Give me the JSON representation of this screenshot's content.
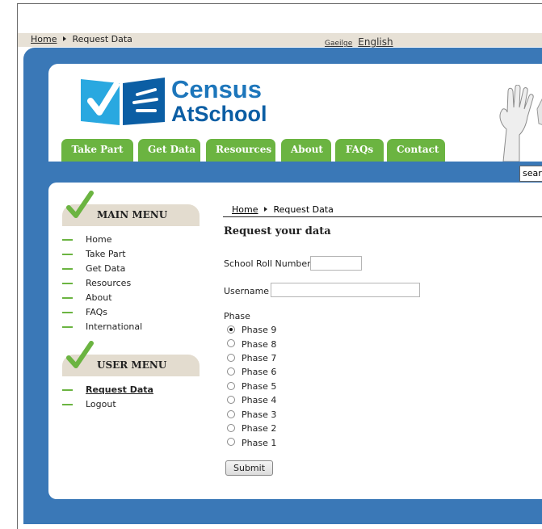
{
  "breadcrumb": {
    "home": "Home",
    "current": "Request Data"
  },
  "languages": {
    "irish": "Gaeilge",
    "english": "English"
  },
  "logo": {
    "line1": "Census",
    "line2": "AtSchool"
  },
  "nav_tabs": [
    "Take Part",
    "Get Data",
    "Resources",
    "About",
    "FAQs",
    "Contact"
  ],
  "search": {
    "value": "sear"
  },
  "main_menu": {
    "title": "MAIN MENU",
    "items": [
      "Home",
      "Take Part",
      "Get Data",
      "Resources",
      "About",
      "FAQs",
      "International"
    ]
  },
  "user_menu": {
    "title": "USER MENU",
    "items": [
      "Request Data",
      "Logout"
    ],
    "active": "Request Data"
  },
  "page": {
    "breadcrumb_home": "Home",
    "breadcrumb_current": "Request Data",
    "title": "Request your data",
    "school_roll_label": "School Roll Number",
    "school_roll_value": "",
    "username_label": "Username",
    "username_value": "",
    "phase_label": "Phase",
    "phases": [
      "Phase 9",
      "Phase 8",
      "Phase 7",
      "Phase 6",
      "Phase 5",
      "Phase 4",
      "Phase 3",
      "Phase 2",
      "Phase 1"
    ],
    "selected_phase": "Phase 9",
    "submit_label": "Submit"
  },
  "colors": {
    "brand_blue": "#3a78b7",
    "tab_green": "#6bb441",
    "logo_blue": "#1d76bb",
    "menu_head": "#e3dccf"
  },
  "icons": [
    "right-triangle-icon",
    "census-checkbook-logo-icon",
    "raised-hand-icon",
    "green-check-icon"
  ]
}
